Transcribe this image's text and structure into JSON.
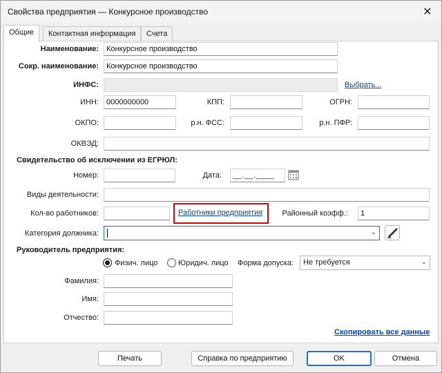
{
  "window": {
    "title": "Свойства предприятия — Конкурсное производство",
    "close_glyph": "✕"
  },
  "tabs": [
    {
      "label": "Общие",
      "active": true
    },
    {
      "label": "Контактная информация",
      "active": false
    },
    {
      "label": "Счета",
      "active": false
    }
  ],
  "general": {
    "name_label": "Наименование:",
    "name_value": "Конкурсное производство",
    "short_name_label": "Сокр. наименование:",
    "short_name_value": "Конкурсное производство",
    "infs_label": "ИНФС:",
    "infs_value": "",
    "select_link": "Выбрать...",
    "inn_label": "ИНН:",
    "inn_value": "0000000000",
    "kpp_label": "КПП:",
    "kpp_value": "",
    "ogrn_label": "ОГРН:",
    "ogrn_value": "",
    "okpo_label": "ОКПО:",
    "okpo_value": "",
    "fss_label": "р.н. ФСС:",
    "fss_value": "",
    "pfr_label": "р.н. ПФР:",
    "pfr_value": "",
    "okved_label": "ОКВЭД:",
    "okved_value": ""
  },
  "egrul": {
    "section_title": "Свидетельство об исключении из ЕГРЮЛ:",
    "number_label": "Номер:",
    "number_value": "",
    "date_label": "Дата:",
    "date_value": "__.__.____",
    "activity_label": "Виды деятельности:",
    "activity_value": "",
    "workers_count_label": "Кол-во работников:",
    "workers_count_value": "",
    "workers_link": "Работники предприятия",
    "district_coef_label": "Районный коэфф.:",
    "district_coef_value": "1",
    "debtor_category_label": "Категория должника:",
    "debtor_category_value": ""
  },
  "head": {
    "section_title": "Руководитель предприятия:",
    "radio_physical": "Физич. лицо",
    "radio_legal": "Юридич. лицо",
    "selected_radio": "physical",
    "access_form_label": "Форма допуска:",
    "access_form_value": "Не требуется",
    "surname_label": "Фамилия:",
    "surname_value": "",
    "first_name_label": "Имя:",
    "first_name_value": "",
    "patronymic_label": "Отчество:",
    "patronymic_value": ""
  },
  "copy_all_link": "Скопировать все данные",
  "buttons": {
    "print": "Печать",
    "reference": "Справка по предприятию",
    "ok": "OK",
    "cancel": "Отмена"
  },
  "colors": {
    "highlight_box": "#e00000",
    "link": "#0645ad",
    "focus": "#1b6ed4"
  }
}
